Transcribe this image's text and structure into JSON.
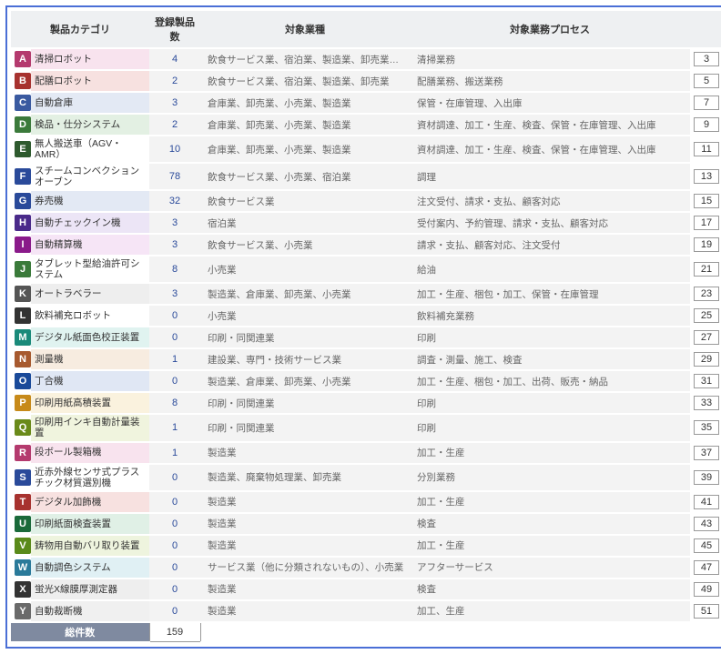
{
  "headers": {
    "category": "製品カテゴリ",
    "count": "登録製品数",
    "industry": "対象業種",
    "process": "対象業務プロセス"
  },
  "rows": [
    {
      "l": "A",
      "lc": "#b43a6e",
      "cat": "清掃ロボット",
      "catbg": "#f8e3ee",
      "cnt": 4,
      "ind": "飲食サービス業、宿泊業、製造業、卸売業、小売業",
      "proc": "清掃業務",
      "n": 3
    },
    {
      "l": "B",
      "lc": "#a7322f",
      "cat": "配膳ロボット",
      "catbg": "#f7e1e0",
      "cnt": 2,
      "ind": "飲食サービス業、宿泊業、製造業、卸売業",
      "proc": "配膳業務、搬送業務",
      "n": 5
    },
    {
      "l": "C",
      "lc": "#3a5aa0",
      "cat": "自動倉庫",
      "catbg": "#e3e9f4",
      "cnt": 3,
      "ind": "倉庫業、卸売業、小売業、製造業",
      "proc": "保管・在庫管理、入出庫",
      "n": 7
    },
    {
      "l": "D",
      "lc": "#3b7a3b",
      "cat": "検品・仕分システム",
      "catbg": "#e3f0e3",
      "cnt": 2,
      "ind": "倉庫業、卸売業、小売業、製造業",
      "proc": "資材調達、加工・生産、検査、保管・在庫管理、入出庫",
      "n": 9
    },
    {
      "l": "E",
      "lc": "#2e5a2e",
      "cat": "無人搬送車（AGV・AMR）",
      "catbg": "#ffffff",
      "cnt": 10,
      "ind": "倉庫業、卸売業、小売業、製造業",
      "proc": "資材調達、加工・生産、検査、保管・在庫管理、入出庫",
      "n": 11
    },
    {
      "l": "F",
      "lc": "#2a4a9a",
      "cat": "スチームコンベクションオーブン",
      "catbg": "#ffffff",
      "cnt": 78,
      "ind": "飲食サービス業、小売業、宿泊業",
      "proc": "調理",
      "n": 13
    },
    {
      "l": "G",
      "lc": "#2a4a9a",
      "cat": "券売機",
      "catbg": "#e3e9f4",
      "cnt": 32,
      "ind": "飲食サービス業",
      "proc": "注文受付、請求・支払、顧客対応",
      "n": 15
    },
    {
      "l": "H",
      "lc": "#4a2a8a",
      "cat": "自動チェックイン機",
      "catbg": "#ece5f6",
      "cnt": 3,
      "ind": "宿泊業",
      "proc": "受付案内、予約管理、請求・支払、顧客対応",
      "n": 17
    },
    {
      "l": "I",
      "lc": "#8a1a8a",
      "cat": "自動精算機",
      "catbg": "#f6e5f6",
      "cnt": 3,
      "ind": "飲食サービス業、小売業",
      "proc": "請求・支払、顧客対応、注文受付",
      "n": 19
    },
    {
      "l": "J",
      "lc": "#3a7a3a",
      "cat": "タブレット型給油許可システム",
      "catbg": "#ffffff",
      "cnt": 8,
      "ind": "小売業",
      "proc": "給油",
      "n": 21
    },
    {
      "l": "K",
      "lc": "#555555",
      "cat": "オートラベラー",
      "catbg": "#eeeeee",
      "cnt": 3,
      "ind": "製造業、倉庫業、卸売業、小売業",
      "proc": "加工・生産、梱包・加工、保管・在庫管理",
      "n": 23
    },
    {
      "l": "L",
      "lc": "#333333",
      "cat": "飲料補充ロボット",
      "catbg": "#ffffff",
      "cnt": 0,
      "ind": "小売業",
      "proc": "飲料補充業務",
      "n": 25
    },
    {
      "l": "M",
      "lc": "#1a8a7a",
      "cat": "デジタル紙面色校正装置",
      "catbg": "#e0f3f0",
      "cnt": 0,
      "ind": "印刷・同関連業",
      "proc": "印刷",
      "n": 27
    },
    {
      "l": "N",
      "lc": "#a75a2f",
      "cat": "測量機",
      "catbg": "#f7ece0",
      "cnt": 1,
      "ind": "建設業、専門・技術サービス業",
      "proc": "調査・測量、施工、検査",
      "n": 29
    },
    {
      "l": "O",
      "lc": "#1a4a9a",
      "cat": "丁合機",
      "catbg": "#e0e7f4",
      "cnt": 0,
      "ind": "製造業、倉庫業、卸売業、小売業",
      "proc": "加工・生産、梱包・加工、出荷、販売・納品",
      "n": 31
    },
    {
      "l": "P",
      "lc": "#c78a1a",
      "cat": "印刷用紙高積装置",
      "catbg": "#faf2de",
      "cnt": 8,
      "ind": "印刷・同関連業",
      "proc": "印刷",
      "n": 33
    },
    {
      "l": "Q",
      "lc": "#6a8a1a",
      "cat": "印刷用インキ自動計量装置",
      "catbg": "#f0f4de",
      "cnt": 1,
      "ind": "印刷・同関連業",
      "proc": "印刷",
      "n": 35
    },
    {
      "l": "R",
      "lc": "#b43a6e",
      "cat": "段ボール製箱機",
      "catbg": "#f8e3ee",
      "cnt": 1,
      "ind": "製造業",
      "proc": "加工・生産",
      "n": 37
    },
    {
      "l": "S",
      "lc": "#2a4a9a",
      "cat": "近赤外線センサ式プラスチック材質選別機",
      "catbg": "#ffffff",
      "cnt": 0,
      "ind": "製造業、廃棄物処理業、卸売業",
      "proc": "分別業務",
      "n": 39
    },
    {
      "l": "T",
      "lc": "#a7322f",
      "cat": "デジタル加飾機",
      "catbg": "#f7e1e0",
      "cnt": 0,
      "ind": "製造業",
      "proc": "加工・生産",
      "n": 41
    },
    {
      "l": "U",
      "lc": "#1a6a3a",
      "cat": "印刷紙面検査装置",
      "catbg": "#e0f0e6",
      "cnt": 0,
      "ind": "製造業",
      "proc": "検査",
      "n": 43
    },
    {
      "l": "V",
      "lc": "#5a8a1a",
      "cat": "鋳物用自動バリ取り装置",
      "catbg": "#eef4de",
      "cnt": 0,
      "ind": "製造業",
      "proc": "加工・生産",
      "n": 45
    },
    {
      "l": "W",
      "lc": "#2a7a9a",
      "cat": "自動調色システム",
      "catbg": "#e0f0f4",
      "cnt": 0,
      "ind": "サービス業（他に分類されないもの）、小売業",
      "proc": "アフターサービス",
      "n": 47
    },
    {
      "l": "X",
      "lc": "#333333",
      "cat": "蛍光X線膜厚測定器",
      "catbg": "#eeeeee",
      "cnt": 0,
      "ind": "製造業",
      "proc": "検査",
      "n": 49
    },
    {
      "l": "Y",
      "lc": "#6a6a6a",
      "cat": "自動裁断機",
      "catbg": "#f0f0f0",
      "cnt": 0,
      "ind": "製造業",
      "proc": "加工、生産",
      "n": 51
    }
  ],
  "total": {
    "label": "総件数",
    "value": 159
  }
}
